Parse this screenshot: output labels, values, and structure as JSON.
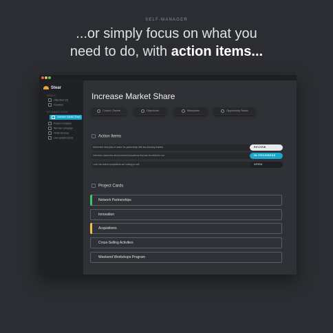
{
  "eyebrow": "SELF-MANAGER",
  "headline": {
    "line1": "...or simply focus on what you",
    "line2_prefix": "need to do, with ",
    "line2_bold": "action items..."
  },
  "sidebar": {
    "brand": "Stear",
    "sections": [
      {
        "label": "GOALS",
        "items": [
          "Objectives (3)",
          "Favorites"
        ]
      },
      {
        "label": "MY OBJECTIVES",
        "items": [
          "Increase Market Share",
          "Project Compass",
          "Win the Campaign",
          "Think Services",
          "Live updates (test)"
        ]
      }
    ],
    "active_item": "Increase Market Share"
  },
  "main": {
    "title": "Increase Market Share",
    "chips": [
      "Collect / Delete",
      "Objectives",
      "Milestones",
      "Opportunity Status"
    ],
    "action_items_heading": "Action Items",
    "action_items": [
      {
        "text": "Determine best plan of action for partnership with two industry leaders",
        "status": "REVIEW",
        "color": "#e9eaec"
      },
      {
        "text": "Interview customers about current innovations that can be added to our",
        "status": "IN PROGRESS",
        "color": "#1ba8cc"
      },
      {
        "text": "Look into which competitors are looking to sell",
        "status": "OPEN",
        "color": "#1f2024"
      }
    ],
    "project_cards_heading": "Project Cards",
    "project_cards": [
      {
        "label": "Network Partnerships",
        "accent": "#3ec46d"
      },
      {
        "label": "Innovation",
        "accent": ""
      },
      {
        "label": "Acquisitions",
        "accent": "#f0bf4c"
      },
      {
        "label": "Cross-Selling Activities",
        "accent": ""
      },
      {
        "label": "Weekend Workshops Program",
        "accent": ""
      }
    ]
  }
}
